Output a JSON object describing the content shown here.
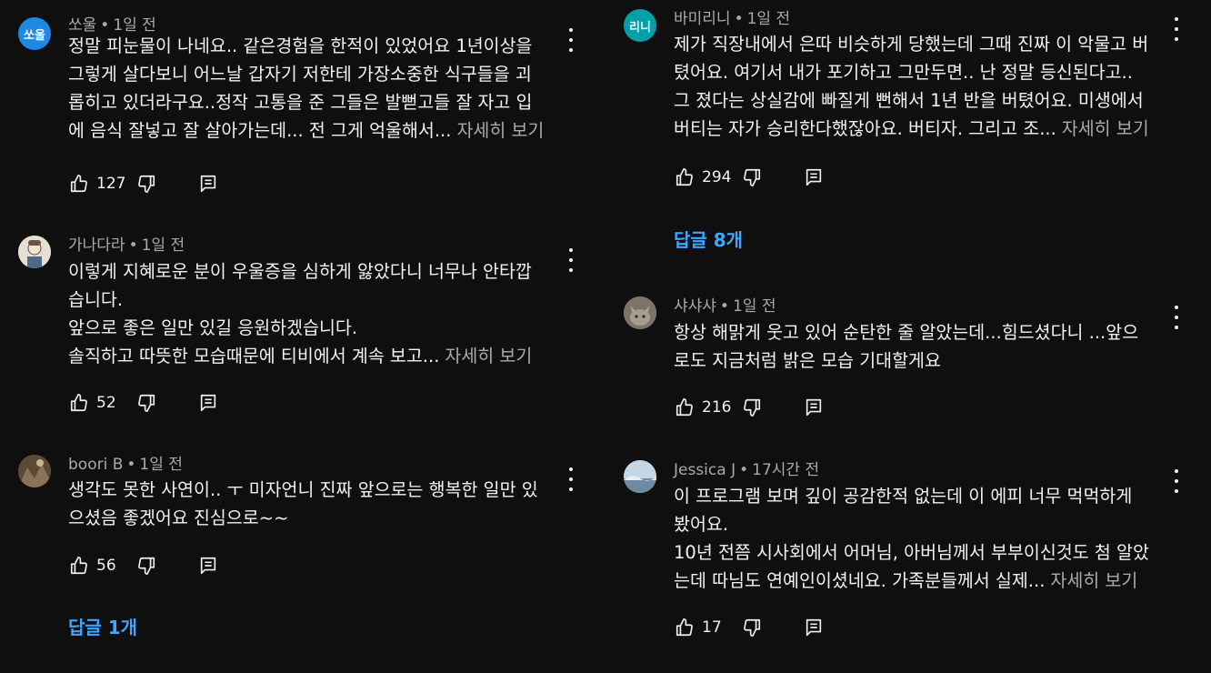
{
  "left": {
    "comments": [
      {
        "avatar_text": "쏘울",
        "avatar_color": "#1e88e5",
        "author": "쏘울",
        "time": "1일 전",
        "lines": [
          "정말 피눈물이 나네요.. 같은경험을 한적이 있었어요 1년이상을",
          "그렇게 살다보니 어느날 갑자기 저한테 가장소중한 식구들을 괴",
          "롭히고 있더라구요..정작 고통을 준 그들은 발뻗고들 잘 자고 입",
          "에 음식 잘넣고 잘 살아가는데... 전 그게 억울해서..."
        ],
        "more": "자세히 보기",
        "likes": "127"
      },
      {
        "avatar_text": "",
        "avatar_color": "#d8d1c4",
        "author": "가나다라",
        "time": "1일 전",
        "lines": [
          "이렇게 지혜로운 분이 우울증을 심하게 앓았다니 너무나 안타깝",
          "습니다.",
          "앞으로 좋은 일만 있길 응원하겠습니다.",
          "솔직하고 따뜻한 모습때문에 티비에서 계속 보고..."
        ],
        "more": "자세히 보기",
        "likes": "52"
      },
      {
        "avatar_text": "",
        "avatar_color": "#6b5a48",
        "author": "boori B",
        "time": "1일 전",
        "lines": [
          "생각도 못한 사연이.. ㅜ 미자언니 진짜 앞으로는 행복한 일만 있",
          "으셨음 좋겠어요 진심으로~~"
        ],
        "more": "",
        "likes": "56"
      }
    ],
    "replies_label": "답글 1개"
  },
  "right": {
    "comments": [
      {
        "avatar_text": "리니",
        "avatar_color": "#00a0a8",
        "author": "바미리니",
        "time": "1일 전",
        "lines": [
          "제가 직장내에서 은따 비슷하게 당했는데 그때 진짜 이 악물고 버",
          "텼어요. 여기서 내가 포기하고 그만두면.. 난 정말 등신된다고..",
          "그 졌다는 상실감에 빠질게 뻔해서 1년 반을 버텼어요. 미생에서",
          "버티는 자가 승리한다했잖아요. 버티자. 그리고 조..."
        ],
        "more": "자세히 보기",
        "likes": "294"
      },
      {
        "avatar_text": "",
        "avatar_color": "#8c877e",
        "author": "샤샤샤",
        "time": "1일 전",
        "lines": [
          "항상 해맑게 웃고 있어 순탄한 줄 알았는데...힘드셨다니 ...앞으",
          "로도 지금처럼 밝은 모습 기대할게요"
        ],
        "more": "",
        "likes": "216"
      },
      {
        "avatar_text": "",
        "avatar_color": "#9fb4c8",
        "author": "Jessica J",
        "time": "17시간 전",
        "lines": [
          "이 프로그램 보며 깊이 공감한적 없는데 이 에피 너무 먹먹하게",
          "봤어요.",
          "10년 전쯤 시사회에서 어머님, 아버님께서 부부이신것도 첨 알았",
          "는데 따님도 연예인이셨네요.  가족분들께서 실제..."
        ],
        "more": "자세히 보기",
        "likes": "17"
      }
    ],
    "replies_label": "답글 8개"
  }
}
